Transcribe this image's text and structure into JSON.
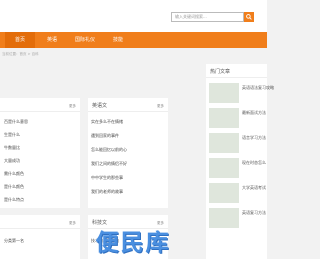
{
  "search": {
    "placeholder": "输入关键词搜索..."
  },
  "nav": [
    "首页",
    "英语",
    "国际礼仪",
    "技能"
  ],
  "breadcrumb": "当前位置：首页 > 百科",
  "left_panel": {
    "title": "",
    "more": "更多",
    "items": [
      "百是什么意思",
      "生是什么",
      "牛数量比",
      "大量成功",
      "需什么颜色",
      "是什么颜色",
      "是什么特点"
    ]
  },
  "english_panel": {
    "title": "英语文",
    "more": "更多",
    "items": [
      "实在多么不在情绪",
      "遇到回家的事件",
      "怎么能回忆以前的心",
      "我们之间的情侣不好",
      "中中学生的那些事",
      "我们的老师的故事"
    ]
  },
  "lower_left_panel": {
    "more": "更多",
    "items": [
      "分类第一名"
    ]
  },
  "lower_right_panel": {
    "title": "科技文",
    "more": "更多",
    "items": [
      "技术的发展方向"
    ]
  },
  "sidebar": {
    "title": "热门文章",
    "items": [
      "英语语法复习攻略",
      "最新面试方法",
      "语言学习方法",
      "现在时态怎么",
      "大学英语考试",
      "英语复习方法"
    ]
  },
  "watermark": "便民库"
}
